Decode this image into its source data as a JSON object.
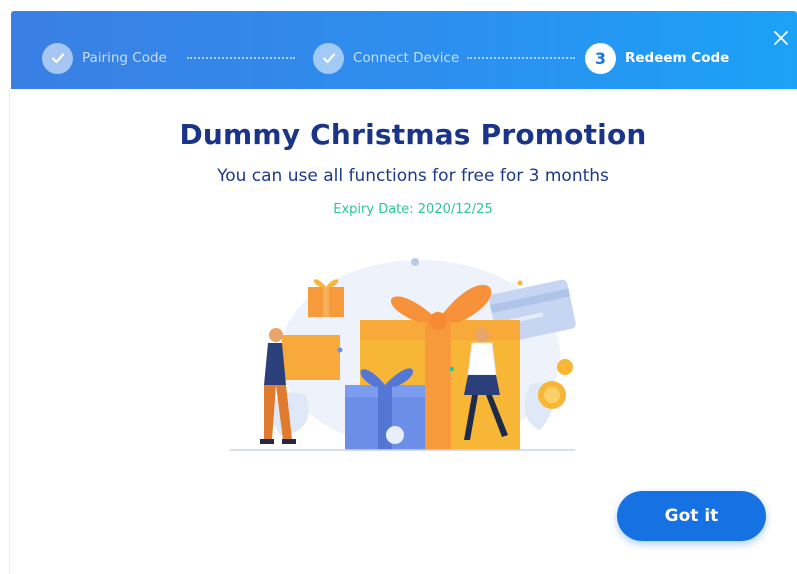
{
  "stepper": {
    "steps": [
      {
        "label": "Pairing Code",
        "state": "done"
      },
      {
        "label": "Connect Device",
        "state": "done"
      },
      {
        "label": "Redeem Code",
        "state": "active",
        "number": "3"
      }
    ]
  },
  "dialog": {
    "close_icon": "close-icon",
    "title": "Dummy Christmas Promotion",
    "subtitle": "You can use all functions for free for 3 months",
    "expiry": "Expiry Date: 2020/12/25",
    "confirm_label": "Got it"
  },
  "colors": {
    "header_gradient_start": "#3b7fe3",
    "header_gradient_end": "#1ba2f7",
    "title": "#1a3487",
    "expiry": "#2cc4a0",
    "button": "#1672e3"
  }
}
